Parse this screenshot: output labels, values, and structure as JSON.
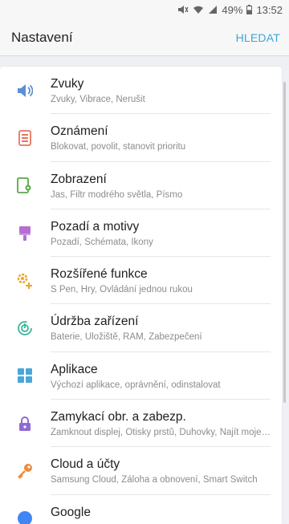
{
  "status_bar": {
    "battery": "49%",
    "time": "13:52"
  },
  "header": {
    "title": "Nastavení",
    "action": "HLEDAT"
  },
  "settings": [
    {
      "label": "Zvuky",
      "sub": "Zvuky, Vibrace, Nerušit",
      "icon": "speaker-icon",
      "color": "#5b8fd6"
    },
    {
      "label": "Oznámení",
      "sub": "Blokovat, povolit, stanovit prioritu",
      "icon": "notification-icon",
      "color": "#e8735d"
    },
    {
      "label": "Zobrazení",
      "sub": "Jas, Filtr modrého světla, Písmo",
      "icon": "display-icon",
      "color": "#5aa84a"
    },
    {
      "label": "Pozadí a motivy",
      "sub": "Pozadí, Schémata, Ikony",
      "icon": "brush-icon",
      "color": "#b56fd0"
    },
    {
      "label": "Rozšířené funkce",
      "sub": "S Pen, Hry, Ovládání jednou rukou",
      "icon": "gears-plus-icon",
      "color": "#e6a825"
    },
    {
      "label": "Údržba zařízení",
      "sub": "Baterie, Úložiště, RAM, Zabezpečení",
      "icon": "device-care-icon",
      "color": "#3bb59a"
    },
    {
      "label": "Aplikace",
      "sub": "Výchozí aplikace, oprávnění, odinstalovat",
      "icon": "apps-grid-icon",
      "color": "#4aa6da"
    },
    {
      "label": "Zamykací obr. a zabezp.",
      "sub": "Zamknout displej, Otisky prstů, Duhovky, Najít moje m…",
      "icon": "lock-icon",
      "color": "#8f6ad6"
    },
    {
      "label": "Cloud a účty",
      "sub": "Samsung Cloud, Záloha a obnovení, Smart Switch",
      "icon": "key-icon",
      "color": "#ef8a3a"
    },
    {
      "label": "Google",
      "sub": "",
      "icon": "google-icon",
      "color": "#4285f4"
    }
  ]
}
